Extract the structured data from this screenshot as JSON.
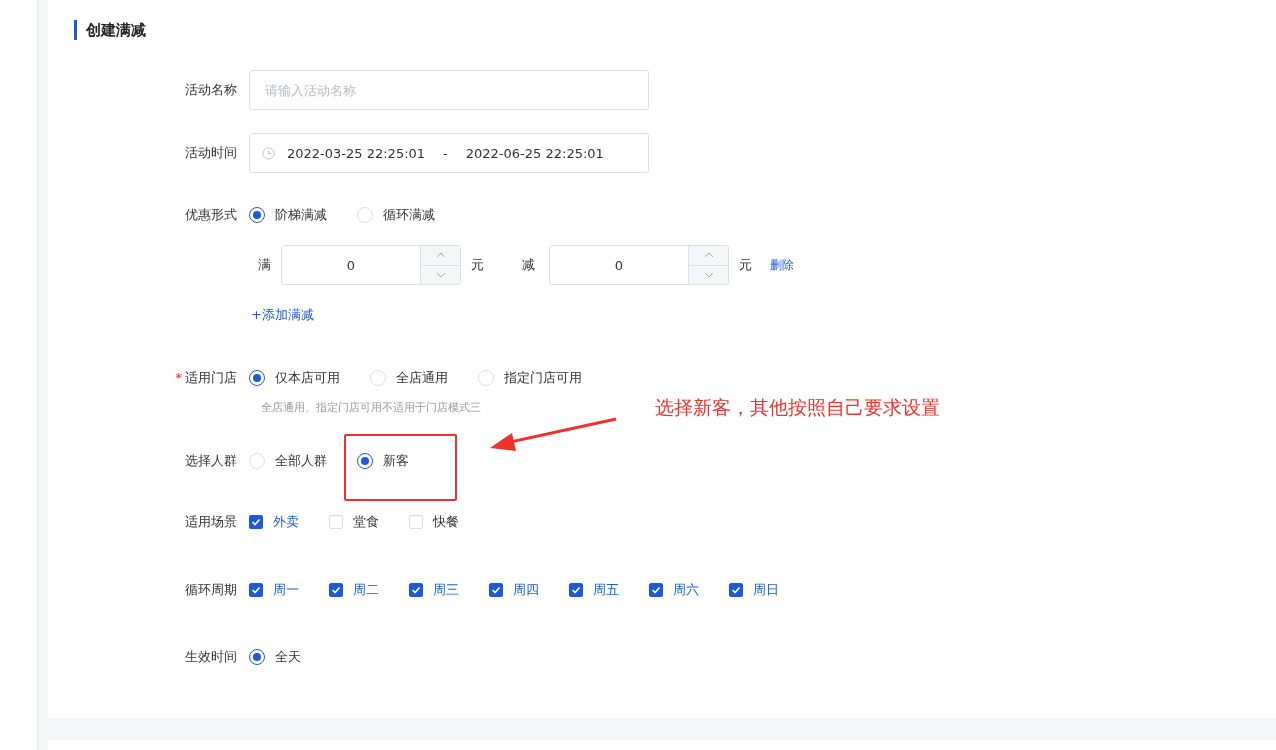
{
  "section_title": "创建满减",
  "form": [
    {
      "kind": "text",
      "label": "活动名称",
      "placeholder": "请输入活动名称"
    },
    {
      "kind": "range",
      "label": "活动时间",
      "start": "2022-03-25 22:25:01",
      "separator": "-",
      "end": "2022-06-25 22:25:01"
    },
    {
      "kind": "radio",
      "label": "优惠形式",
      "options": [
        {
          "label": "阶梯满减",
          "selected": true
        },
        {
          "label": "循环满减",
          "selected": false
        }
      ]
    },
    {
      "kind": "tier",
      "full_label": "满",
      "full_value": "0",
      "full_unit": "元",
      "minus_label": "减",
      "minus_value": "0",
      "minus_unit": "元",
      "delete": "删除"
    },
    {
      "kind": "add",
      "text": "+添加满减"
    },
    {
      "kind": "radio",
      "label": "适用门店",
      "required_mark": "*",
      "options": [
        {
          "label": "仅本店可用",
          "selected": true
        },
        {
          "label": "全店通用",
          "selected": false
        },
        {
          "label": "指定门店可用",
          "selected": false
        }
      ],
      "hint": "全店通用、指定门店可用不适用于门店模式三"
    },
    {
      "kind": "radio",
      "label": "选择人群",
      "options": [
        {
          "label": "全部人群",
          "selected": false
        },
        {
          "label": "新客",
          "selected": true
        }
      ]
    },
    {
      "kind": "checkbox",
      "label": "适用场景",
      "options": [
        {
          "label": "外卖",
          "checked": true
        },
        {
          "label": "堂食",
          "checked": false
        },
        {
          "label": "快餐",
          "checked": false
        }
      ]
    },
    {
      "kind": "checkbox",
      "label": "循环周期",
      "options": [
        {
          "label": "周一",
          "checked": true
        },
        {
          "label": "周二",
          "checked": true
        },
        {
          "label": "周三",
          "checked": true
        },
        {
          "label": "周四",
          "checked": true
        },
        {
          "label": "周五",
          "checked": true
        },
        {
          "label": "周六",
          "checked": true
        },
        {
          "label": "周日",
          "checked": true
        }
      ]
    },
    {
      "kind": "radio",
      "label": "生效时间",
      "options": [
        {
          "label": "全天",
          "selected": true
        }
      ]
    }
  ],
  "annotation": {
    "text": "选择新客，其他按照自己要求设置"
  }
}
